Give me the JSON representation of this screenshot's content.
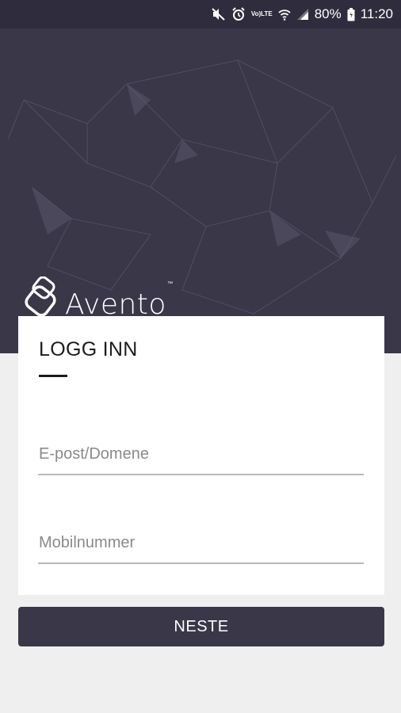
{
  "status_bar": {
    "battery": "80%",
    "time": "11:20",
    "volte_top": "Vo)",
    "volte_bottom": "LTE",
    "icons": [
      "mute-icon",
      "alarm-icon",
      "volte-icon",
      "wifi-icon",
      "signal-icon",
      "battery-icon"
    ]
  },
  "brand": {
    "name": "Avento",
    "trademark": "™"
  },
  "login": {
    "title": "LOGG INN",
    "email_placeholder": "E-post/Domene",
    "phone_placeholder": "Mobilnummer",
    "next_label": "NESTE"
  },
  "colors": {
    "status_bar": "#2f2d3d",
    "hero_background": "#3a3749",
    "page_background": "#efefef",
    "button_background": "#3a3749"
  }
}
